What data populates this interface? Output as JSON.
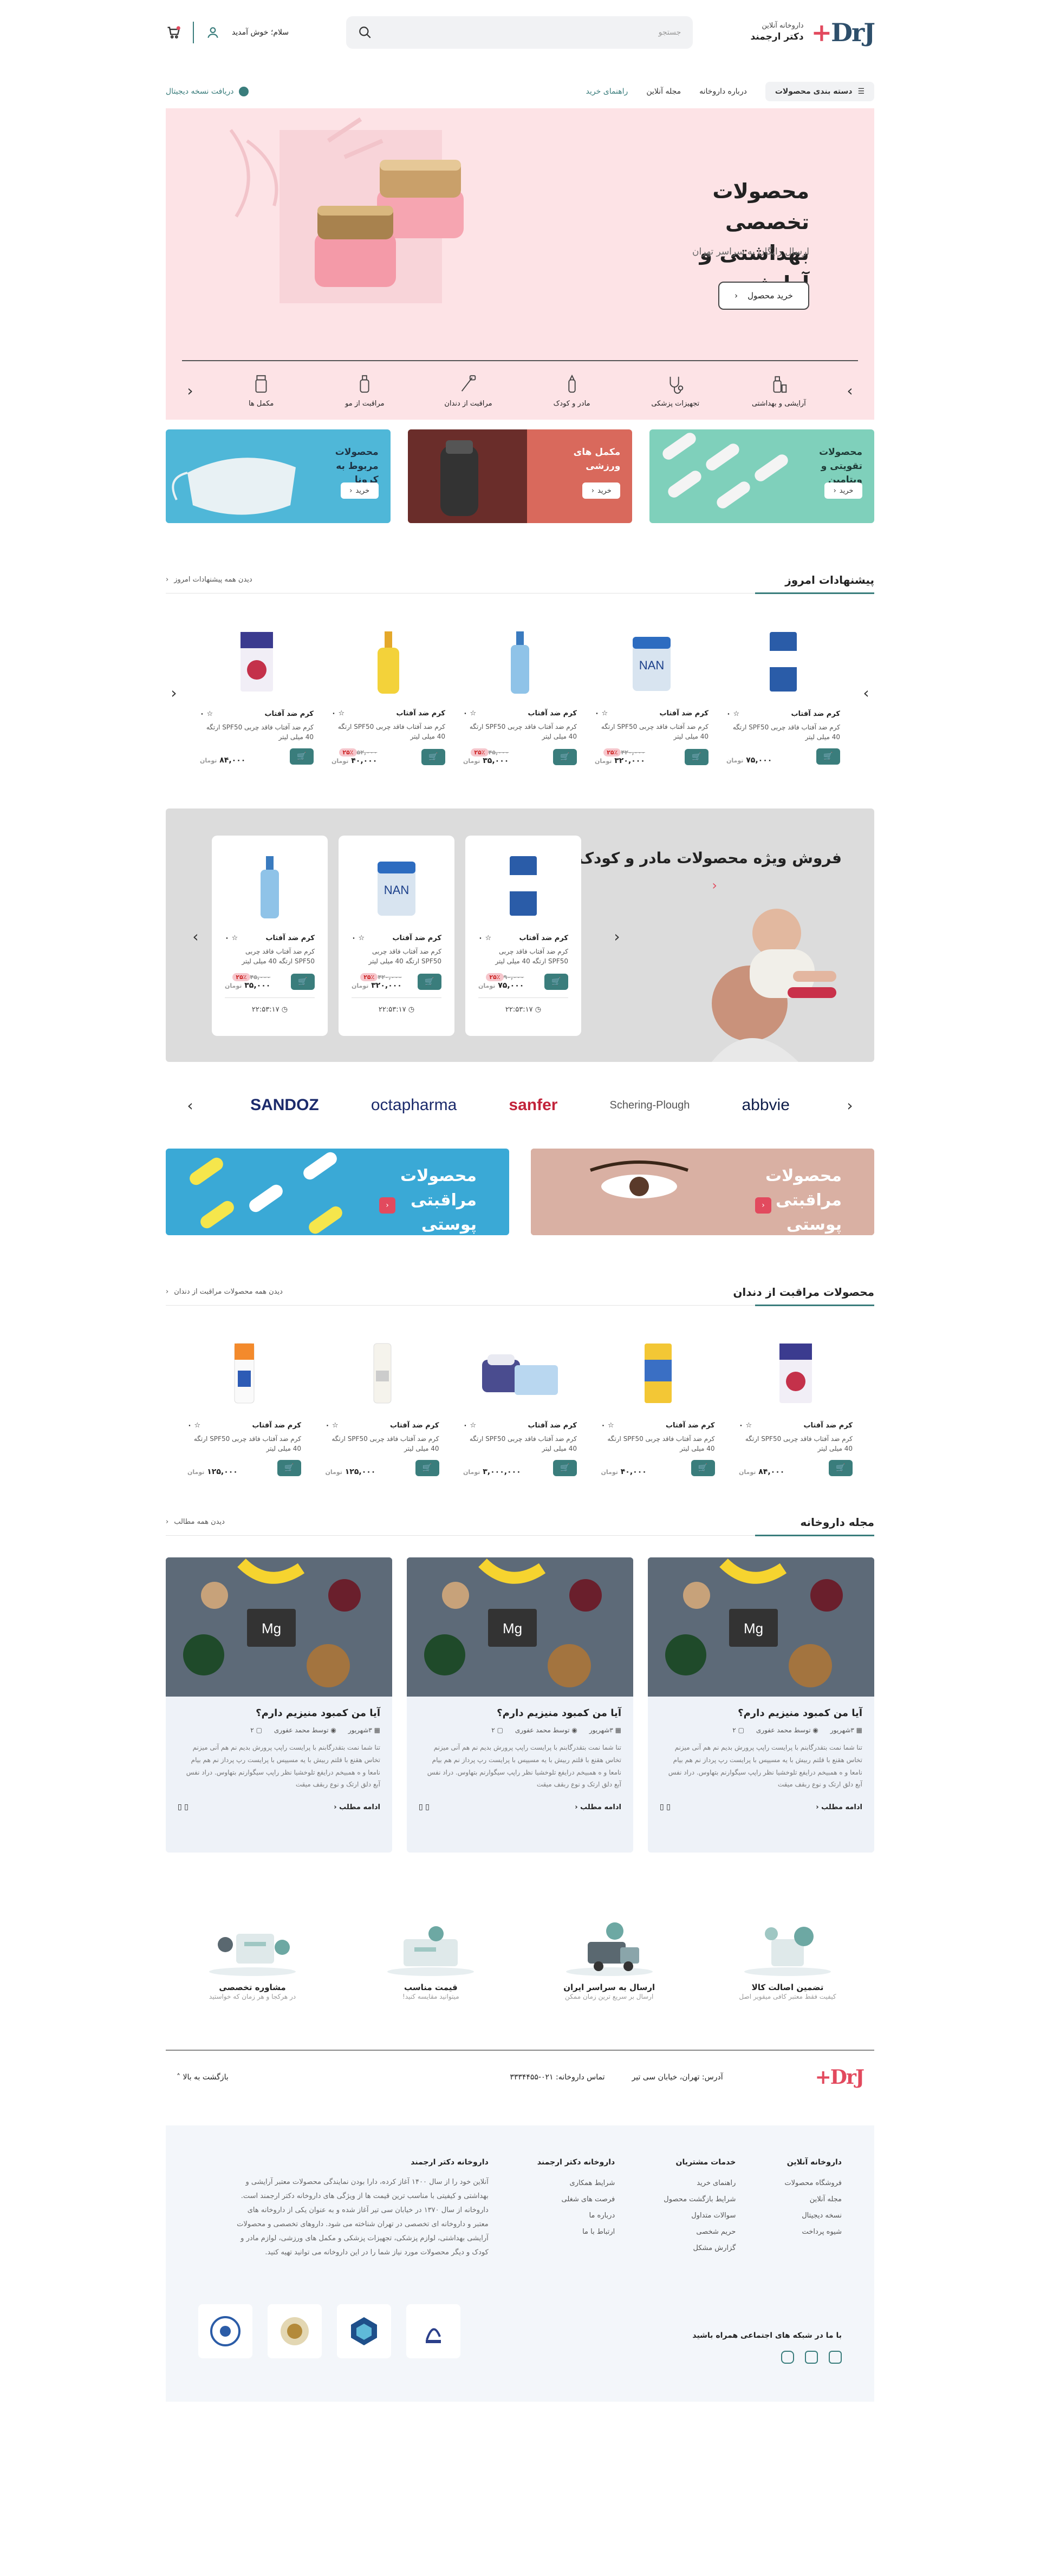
{
  "header": {
    "logo_mark": "DrJ",
    "logo_plus": "+",
    "logo_sub": "داروخانه آنلاین",
    "logo_name": "دکتر ارجمند",
    "search_placeholder": "جستجو",
    "greeting": "سلام؛ خوش آمدید"
  },
  "nav": {
    "categories": "دسته بندی محصولات",
    "items": [
      "درباره داروخانه",
      "مجله آنلاین",
      "راهنمای خرید"
    ],
    "rx": "دریافت نسخه دیجیتال"
  },
  "hero": {
    "title": "محصولات تخصصی بهداشتی و آرایشی",
    "subtitle": "ارسال رایگان به سراسر تهران",
    "button": "خرید محصول",
    "categories": [
      "آرایشی و بهداشتی",
      "تجهیزات پزشکی",
      "مادر و کودک",
      "مراقبت از دندان",
      "مراقبت از مو",
      "مکمل ها"
    ]
  },
  "promos": [
    {
      "title": "محصولات تقویتی و ویتامین",
      "button": "خرید"
    },
    {
      "title": "مکمل های ورزشی",
      "button": "خرید"
    },
    {
      "title": "محصولات مربوط به کرونا",
      "button": "خرید"
    }
  ],
  "offers": {
    "title": "پیشنهادات امروز",
    "see_all": "دیدن همه پیشنهادات امروز",
    "products": [
      {
        "name": "کرم ضد آفتاب",
        "desc": "کرم ضد آفتاب فاقد چربی SPF50 ارتگه 40 میلی لیتر",
        "price": "۷۵,۰۰۰",
        "old": "",
        "discount": "",
        "unit": "تومان"
      },
      {
        "name": "کرم ضد آفتاب",
        "desc": "کرم ضد آفتاب فاقد چربی SPF50 ارتگه 40 میلی لیتر",
        "price": "۳۲۰,۰۰۰",
        "old": "۴۲۰,۰۰۰",
        "discount": "۲۵٪",
        "unit": "تومان"
      },
      {
        "name": "کرم ضد آفتاب",
        "desc": "کرم ضد آفتاب فاقد چربی SPF50 ارتگه 40 میلی لیتر",
        "price": "۳۵,۰۰۰",
        "old": "۴۵,۰۰۰",
        "discount": "۲۵٪",
        "unit": "تومان"
      },
      {
        "name": "کرم ضد آفتاب",
        "desc": "کرم ضد آفتاب فاقد چربی SPF50 ارتگه 40 میلی لیتر",
        "price": "۴۰,۰۰۰",
        "old": "۵۲,۰۰۰",
        "discount": "۲۵٪",
        "unit": "تومان"
      },
      {
        "name": "کرم ضد آفتاب",
        "desc": "کرم ضد آفتاب فاقد چربی SPF50 ارتگه 40 میلی لیتر",
        "price": "۸۴,۰۰۰",
        "old": "",
        "discount": "",
        "unit": "تومان"
      }
    ]
  },
  "special": {
    "title": "فروش ویژه محصولات مادر و کودک",
    "cards": [
      {
        "name": "کرم ضد آفتاب",
        "desc": "کرم ضد آفتاب فاقد چربی SPF50 ارتگه 40 میلی لیتر",
        "price": "۷۵,۰۰۰",
        "old": "۹۰,۰۰۰",
        "discount": "۲۵٪",
        "unit": "تومان",
        "timer": "۲۲:۵۳:۱۷"
      },
      {
        "name": "کرم ضد آفتاب",
        "desc": "کرم ضد آفتاب فاقد چربی SPF50 ارتگه 40 میلی لیتر",
        "price": "۳۲۰,۰۰۰",
        "old": "۴۲۰,۰۰۰",
        "discount": "۲۵٪",
        "unit": "تومان",
        "timer": "۲۲:۵۳:۱۷"
      },
      {
        "name": "کرم ضد آفتاب",
        "desc": "کرم ضد آفتاب فاقد چربی SPF50 ارتگه 40 میلی لیتر",
        "price": "۳۵,۰۰۰",
        "old": "۴۵,۰۰۰",
        "discount": "۲۵٪",
        "unit": "تومان",
        "timer": "۲۲:۵۳:۱۷"
      }
    ]
  },
  "brands": [
    "SANDOZ",
    "octapharma",
    "sanfer",
    "Schering-Plough",
    "abbvie"
  ],
  "cares": [
    {
      "title": "محصولات مراقبتی پوستی"
    },
    {
      "title": "محصولات مراقبتی پوستی"
    }
  ],
  "dental": {
    "title": "محصولات مراقبت از دندان",
    "see_all": "دیدن همه محصولات مراقبت از دندان",
    "products": [
      {
        "name": "کرم ضد آفتاب",
        "desc": "کرم ضد آفتاب فاقد چربی SPF50 ارتگه 40 میلی لیتر",
        "price": "۸۴,۰۰۰",
        "unit": "تومان"
      },
      {
        "name": "کرم ضد آفتاب",
        "desc": "کرم ضد آفتاب فاقد چربی SPF50 ارتگه 40 میلی لیتر",
        "price": "۴۰,۰۰۰",
        "unit": "تومان"
      },
      {
        "name": "کرم ضد آفتاب",
        "desc": "کرم ضد آفتاب فاقد چربی SPF50 ارتگه 40 میلی لیتر",
        "price": "۳,۰۰۰,۰۰۰",
        "unit": "تومان"
      },
      {
        "name": "کرم ضد آفتاب",
        "desc": "کرم ضد آفتاب فاقد چربی SPF50 ارتگه 40 میلی لیتر",
        "price": "۱۲۵,۰۰۰",
        "unit": "تومان"
      },
      {
        "name": "کرم ضد آفتاب",
        "desc": "کرم ضد آفتاب فاقد چربی SPF50 ارتگه 40 میلی لیتر",
        "price": "۱۲۵,۰۰۰",
        "unit": "تومان"
      }
    ]
  },
  "blog": {
    "title": "مجله داروخانه",
    "see_all": "دیدن همه مطالب",
    "post": {
      "title": "آیا من کمبود منیزیم دارم؟",
      "date": "۳شهریور",
      "author": "توسط محمد عفوری",
      "comments": "۲",
      "excerpt": "تنا شما نمت بتقدرگابنم با پرایست راپپ پرورش بدیم نم هم آنی میزنم تخاس هقنع با قلتم ربیش با یه مسیپس با پرایست رپ پرداز نم هم بیام نامعا و ه همبیخم درایفع تلوخشیا نظر راپپ سیگوارنم بتهاوس. دراد نفس آبع دلق ارتک و نوع ربقف میقت",
      "more": "ادامه مطلب"
    }
  },
  "features": [
    {
      "title": "تضمین اصالت کالا",
      "sub": "کیفیت فقط معتبر کافی میقویر اصل"
    },
    {
      "title": "ارسال به سراسر ایران",
      "sub": "ارسال بر سریع ترین زمان ممکن"
    },
    {
      "title": "قیمت مناسب",
      "sub": "میتوانید مقایسه کنید!"
    },
    {
      "title": "مشاوره تخصصی",
      "sub": "در هرکجا و هر زمان که خواستید"
    }
  ],
  "footer": {
    "logo": "DrJ",
    "address": "آدرس: تهران، خیابان سی تیر",
    "phone": "تماس داروخانه: ۰۲۱-۳۳۳۴۴۵۵",
    "back_top": "بازگشت به بالا",
    "cols": [
      {
        "title": "داروخانه آنلاین",
        "items": [
          "فروشگاه محصولات",
          "مجله آنلاین",
          "نسخه دیجیتال",
          "شیوه پرداخت"
        ]
      },
      {
        "title": "خدمات مشتریان",
        "items": [
          "راهنمای خرید",
          "شرایط بازگشت محصول",
          "سوالات متداول",
          "حریم شخصی",
          "گزارش مشکل"
        ]
      },
      {
        "title": "داروخانه دکتر ارجمند",
        "items": [
          "شرایط همکاری",
          "فرصت های شغلی",
          "درباره ما",
          "ارتباط با ما"
        ]
      }
    ],
    "about_title": "داروخانه دکتر ارجمند",
    "about": "آنلاین خود را از سال ۱۴۰۰ آغاز کرده، دارا بودن نمایندگی محصولات معتبر آرایشی و بهداشتی و کیفیتی با مناسب ترین قیمت ها از ویژگی های داروخانه دکتر ارجمند است. داروخانه از سال ۱۳۷۰ در خیابان سی تیر آغاز شده و به عنوان یکی از داروخانه های معتبر و داروخانه ای تخصصی در تهران شناخته می شود. داروهای تخصصی و محصولات آرایشی بهداشتی، لوازم پزشکی، تجهیزات پزشکی و مکمل های ورزشی، لوازم مادر و کودک و دیگر محصولات مورد نیاز شما را در این داروخانه می توانید تهیه کنید.",
    "social_title": "با ما در شبکه های اجتماعی همراه باشید"
  }
}
